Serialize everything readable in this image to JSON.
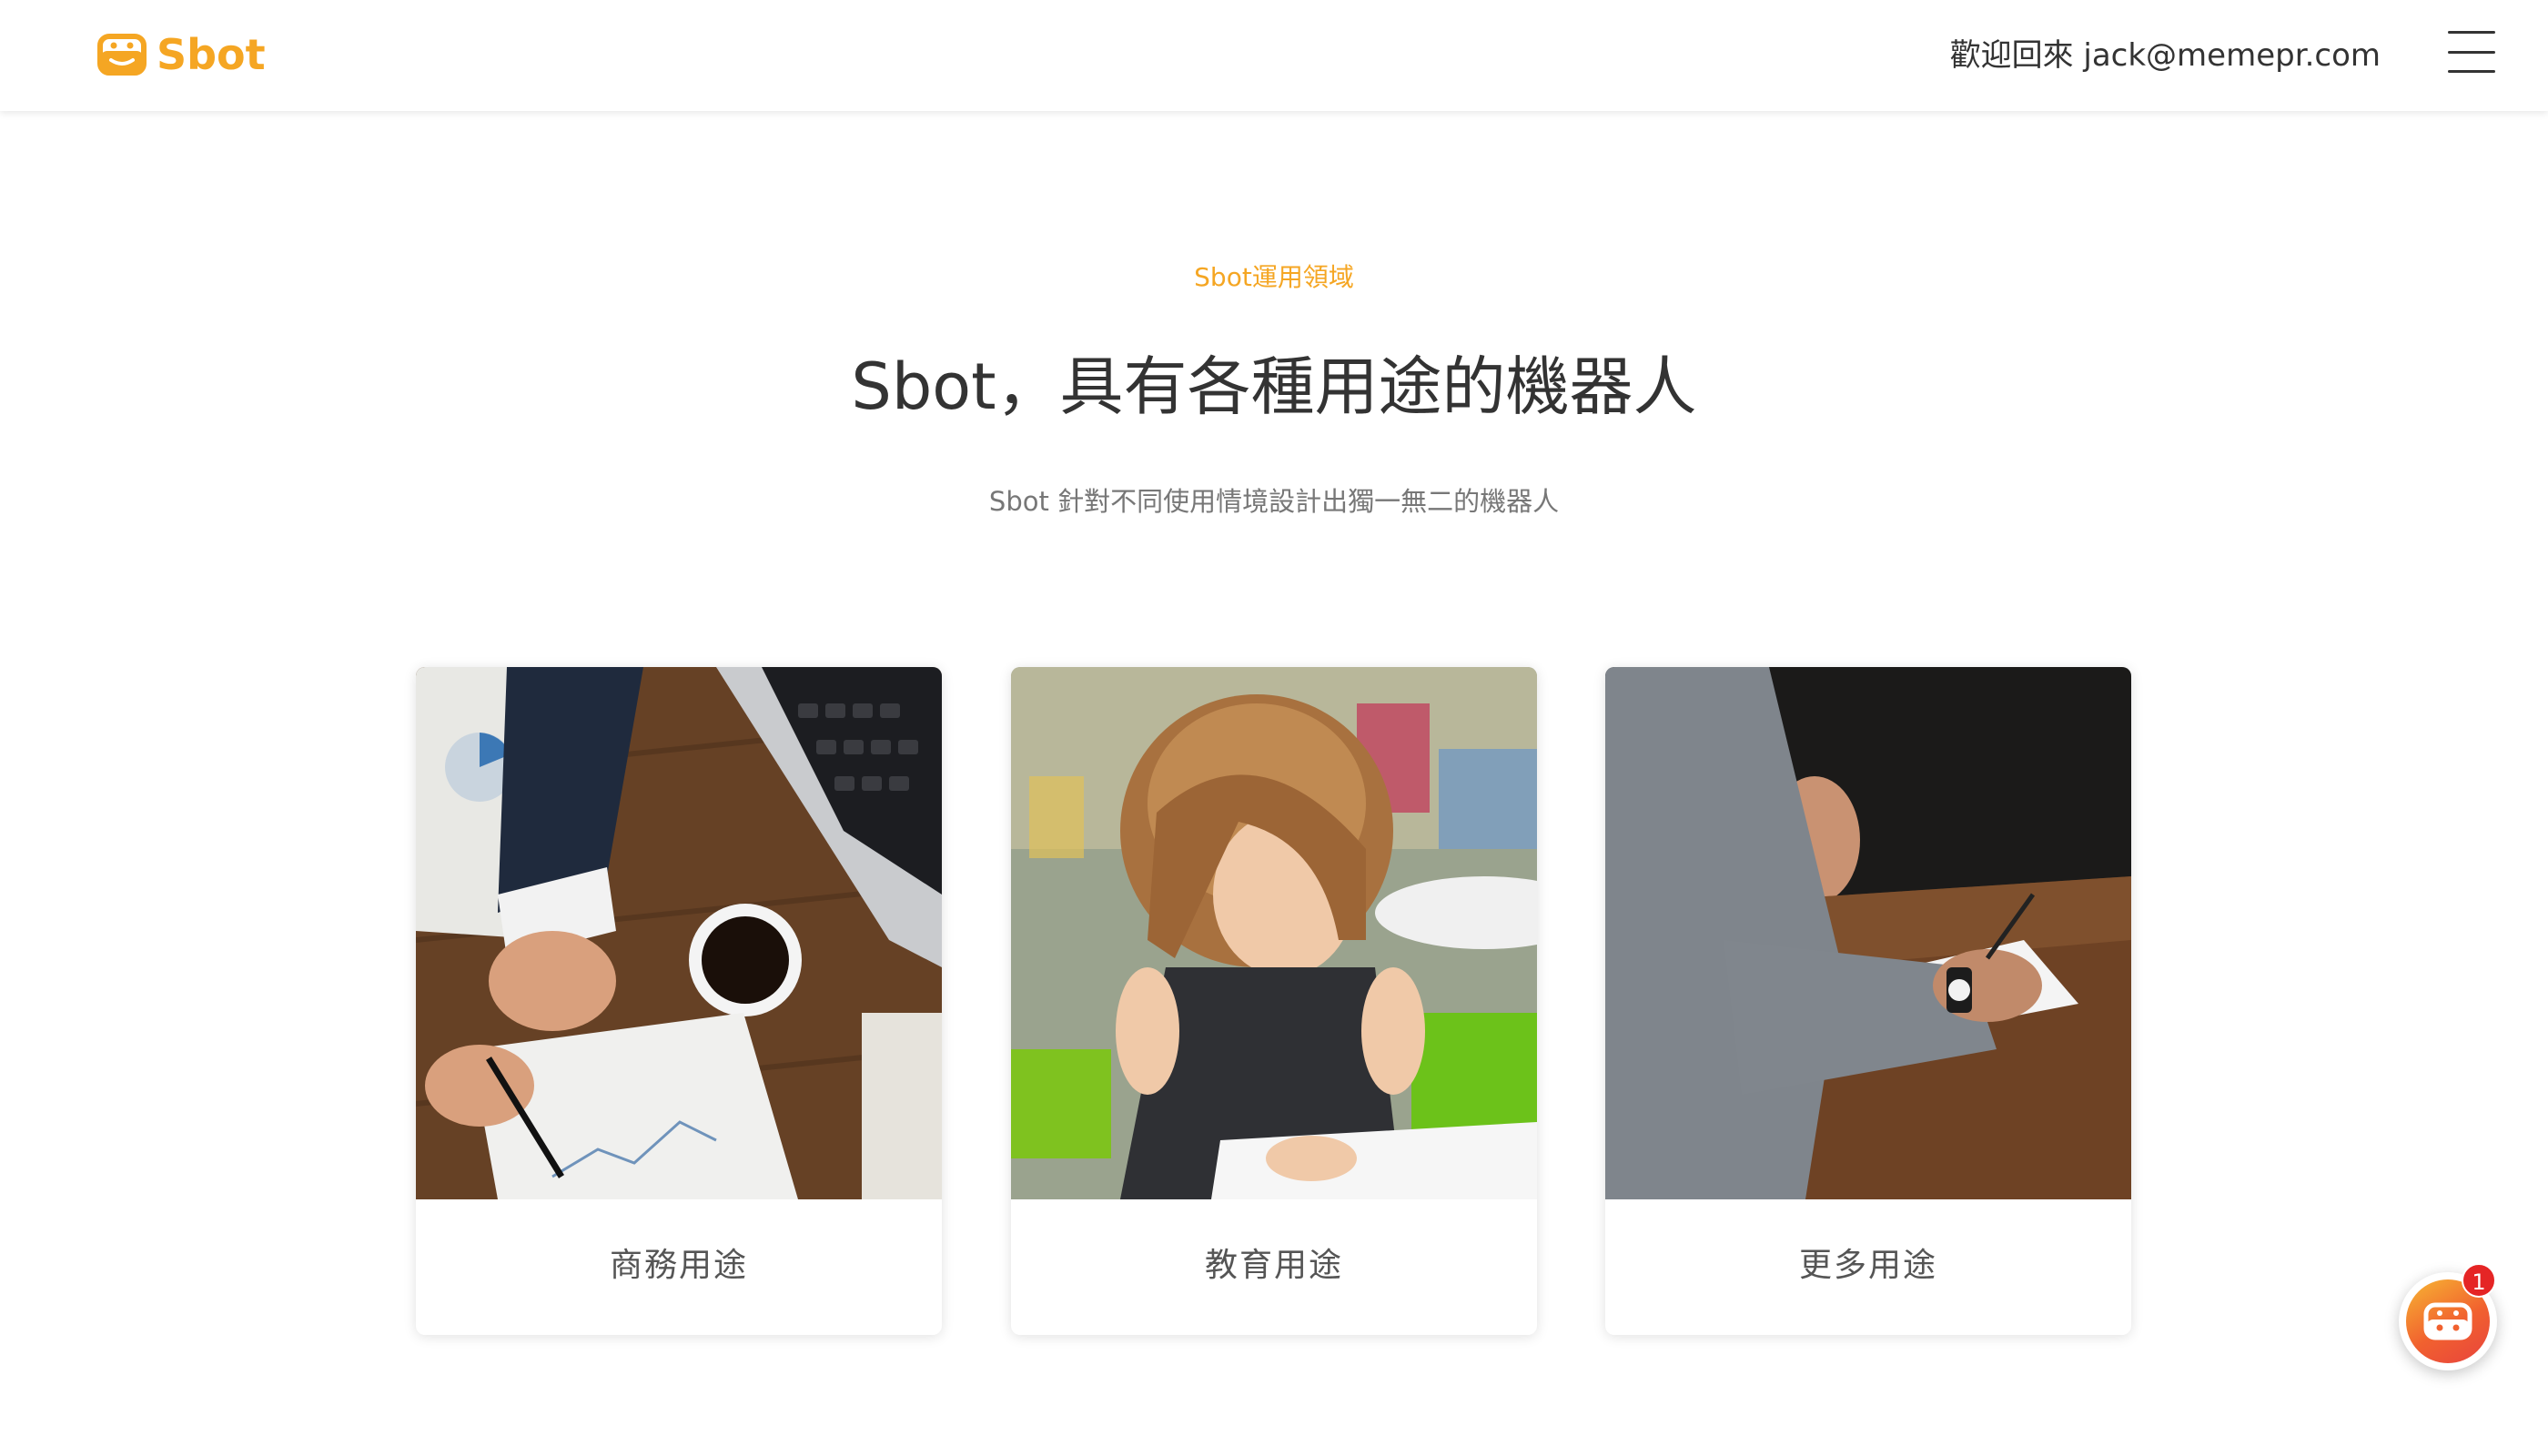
{
  "header": {
    "logo_text": "Sbot",
    "welcome_text": "歡迎回來 jack@memepr.com",
    "menu_icon": "hamburger-menu-icon"
  },
  "intro": {
    "eyebrow": "Sbot運用領域",
    "title": "Sbot，具有各種用途的機器人",
    "subtitle": "Sbot 針對不同使用情境設計出獨一無二的機器人"
  },
  "cards": [
    {
      "label": "商務用途",
      "image": "business-desk-photo"
    },
    {
      "label": "教育用途",
      "image": "child-studying-photo"
    },
    {
      "label": "更多用途",
      "image": "discussion-meeting-photo"
    }
  ],
  "chat_widget": {
    "badge_count": "1",
    "icon": "bot-face-icon"
  },
  "colors": {
    "brand_orange": "#f5a623",
    "badge_red": "#e52525",
    "title_text": "#333333",
    "subtitle_text": "#777777"
  }
}
